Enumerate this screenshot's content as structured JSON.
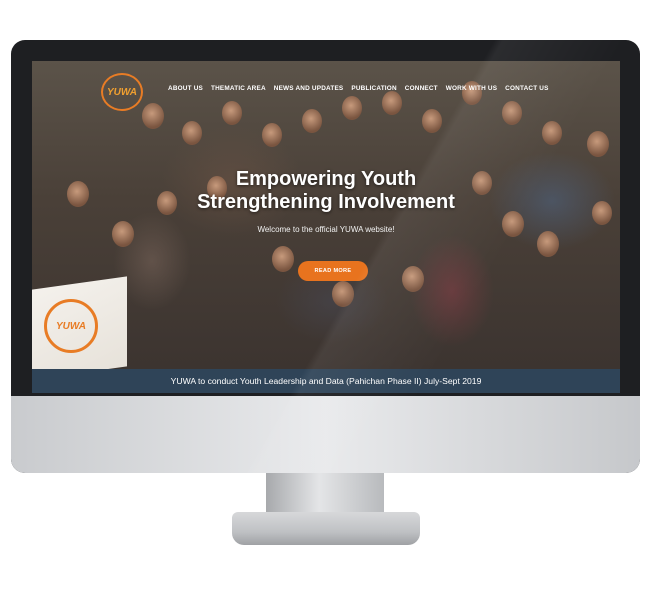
{
  "site": {
    "logo_text": "YUWA",
    "banner_logo_text": "YUWA"
  },
  "nav": {
    "items": [
      "ABOUT US",
      "THEMATIC AREA",
      "NEWS AND UPDATES",
      "PUBLICATION",
      "CONNECT",
      "WORK WITH US",
      "CONTACT US"
    ]
  },
  "hero": {
    "headline_line1": "Empowering Youth",
    "headline_line2": "Strengthening Involvement",
    "welcome": "Welcome to the official YUWA website!",
    "cta_label": "READ MORE"
  },
  "ticker": {
    "text": "YUWA to conduct Youth Leadership and Data (Pahichan Phase II) July-Sept 2019"
  },
  "colors": {
    "accent": "#e8731e",
    "ticker_bg": "#2f4458",
    "bezel": "#1e1f22"
  }
}
